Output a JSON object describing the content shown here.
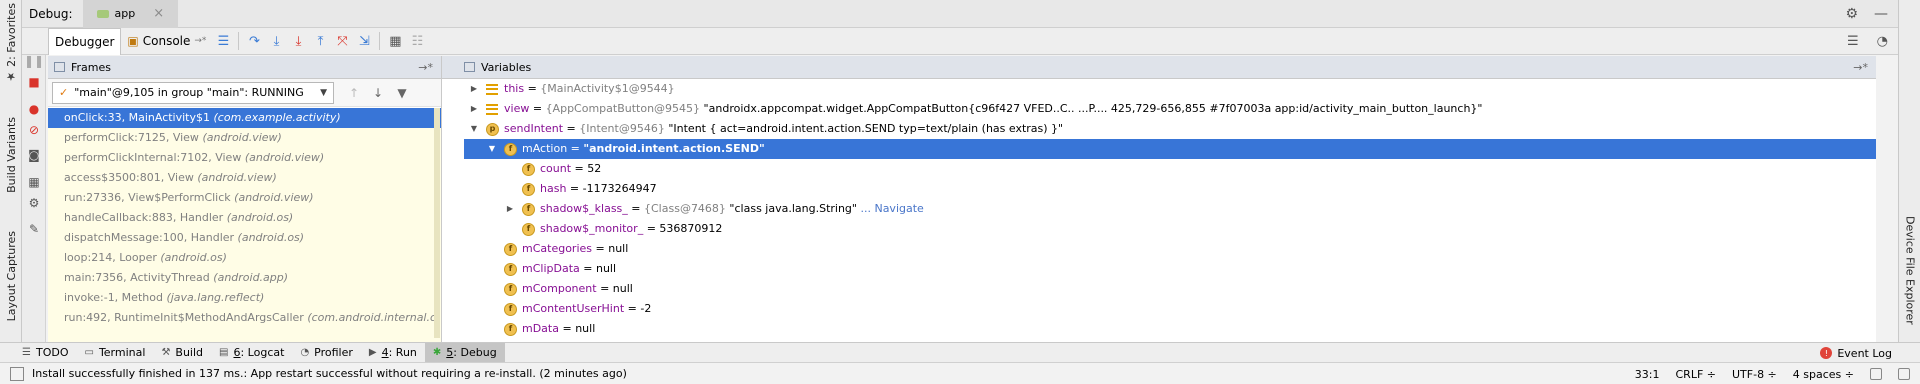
{
  "left_stripe": {
    "favorites": "2: Favorites",
    "build_variants": "Build Variants",
    "layout_captures": "Layout Captures"
  },
  "right_stripe": {
    "device_file_explorer": "Device File Explorer"
  },
  "titlebar": {
    "label": "Debug:",
    "app_tab": "app"
  },
  "toolbar": {
    "debugger_tab": "Debugger",
    "console_tab": "Console",
    "console_suffix": "→*"
  },
  "frames": {
    "title": "Frames",
    "thread": "\"main\"@9,105 in group \"main\": RUNNING",
    "rows": [
      {
        "method": "onClick:33, MainActivity$1",
        "pkg": "(com.example.activity)"
      },
      {
        "method": "performClick:7125, View",
        "pkg": "(android.view)"
      },
      {
        "method": "performClickInternal:7102, View",
        "pkg": "(android.view)"
      },
      {
        "method": "access$3500:801, View",
        "pkg": "(android.view)"
      },
      {
        "method": "run:27336, View$PerformClick",
        "pkg": "(android.view)"
      },
      {
        "method": "handleCallback:883, Handler",
        "pkg": "(android.os)"
      },
      {
        "method": "dispatchMessage:100, Handler",
        "pkg": "(android.os)"
      },
      {
        "method": "loop:214, Looper",
        "pkg": "(android.os)"
      },
      {
        "method": "main:7356, ActivityThread",
        "pkg": "(android.app)"
      },
      {
        "method": "invoke:-1, Method",
        "pkg": "(java.lang.reflect)"
      },
      {
        "method": "run:492, RuntimeInit$MethodAndArgsCaller",
        "pkg": "(com.android.internal.o"
      }
    ]
  },
  "variables": {
    "title": "Variables",
    "rows": [
      {
        "name": "this",
        "eq": " = ",
        "type": "{MainActivity$1@9544}",
        "value": ""
      },
      {
        "name": "view",
        "eq": " = ",
        "type": "{AppCompatButton@9545}",
        "value": " \"androidx.appcompat.widget.AppCompatButton{c96f427 VFED..C.. ...P.... 425,729-656,855 #7f07003a app:id/activity_main_button_launch}\""
      },
      {
        "name": "sendIntent",
        "eq": " = ",
        "type": "{Intent@9546}",
        "value": " \"Intent { act=android.intent.action.SEND typ=text/plain (has extras) }\""
      },
      {
        "name": "mAction",
        "eq": " = ",
        "type": "",
        "value": "\"android.intent.action.SEND\""
      },
      {
        "name": "count",
        "eq": " = ",
        "type": "",
        "value": "52"
      },
      {
        "name": "hash",
        "eq": " = ",
        "type": "",
        "value": "-1173264947"
      },
      {
        "name": "shadow$_klass_",
        "eq": " = ",
        "type": "{Class@7468}",
        "value": " \"class java.lang.String\"",
        "nav": " ... Navigate"
      },
      {
        "name": "shadow$_monitor_",
        "eq": " = ",
        "type": "",
        "value": "536870912"
      },
      {
        "name": "mCategories",
        "eq": " = ",
        "type": "",
        "value": "null"
      },
      {
        "name": "mClipData",
        "eq": " = ",
        "type": "",
        "value": "null"
      },
      {
        "name": "mComponent",
        "eq": " = ",
        "type": "",
        "value": "null"
      },
      {
        "name": "mContentUserHint",
        "eq": " = ",
        "type": "",
        "value": "-2"
      },
      {
        "name": "mData",
        "eq": " = ",
        "type": "",
        "value": "null"
      }
    ]
  },
  "tool_windows": {
    "todo": "TODO",
    "terminal": "Terminal",
    "build": "Build",
    "logcat_num": "6",
    "logcat": ": Logcat",
    "profiler": "Profiler",
    "run_num": "4",
    "run": ": Run",
    "debug_num": "5",
    "debug": ": Debug",
    "event_log": "Event Log"
  },
  "status": {
    "message": "Install successfully finished in 137 ms.: App restart successful without requiring a re-install. (2 minutes ago)",
    "position": "33:1",
    "line_sep": "CRLF ÷",
    "encoding": "UTF-8 ÷",
    "indent": "4 spaces ÷"
  },
  "colors": {
    "selection": "#3875d7",
    "frames_bg": "#fffde6",
    "var_name": "#871094",
    "panel_header": "#dfe3ea"
  }
}
